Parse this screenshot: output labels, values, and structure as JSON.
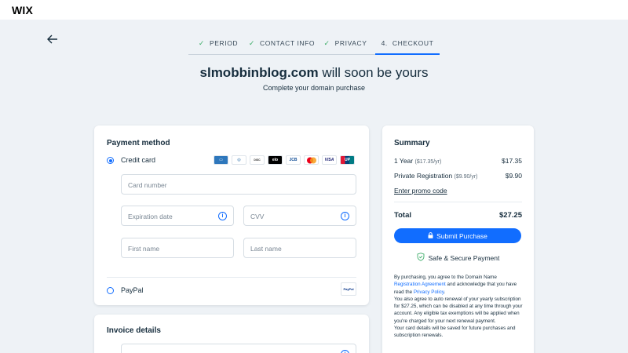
{
  "brand": {
    "logo": "WIX"
  },
  "steps": [
    {
      "label": "PERIOD",
      "done": true
    },
    {
      "label": "CONTACT INFO",
      "done": true
    },
    {
      "label": "PRIVACY",
      "done": true
    },
    {
      "number": "4.",
      "label": "CHECKOUT",
      "active": true
    }
  ],
  "header": {
    "domain": "slmobbinblog.com",
    "title_rest": " will soon be yours",
    "subtitle": "Complete your domain purchase"
  },
  "payment": {
    "title": "Payment method",
    "credit_card_label": "Credit card",
    "card_logos": [
      "AMEX",
      "DINERS",
      "DISCOVER",
      "elo",
      "JCB",
      "MC",
      "VISA",
      "UP"
    ],
    "fields": {
      "card_number": "Card number",
      "expiration": "Expiration date",
      "cvv": "CVV",
      "first_name": "First name",
      "last_name": "Last name"
    },
    "paypal_label": "PayPal",
    "paypal_logo": "PayPal"
  },
  "invoice": {
    "title": "Invoice details"
  },
  "summary": {
    "title": "Summary",
    "rows": [
      {
        "label": "1 Year",
        "detail": "($17.35/yr)",
        "amount": "$17.35"
      },
      {
        "label": "Private Registration",
        "detail": "($9.90/yr)",
        "amount": "$9.90"
      }
    ],
    "promo_link": "Enter promo code",
    "total_label": "Total",
    "total_amount": "$27.25",
    "submit_label": "Submit Purchase",
    "secure_label": "Safe & Secure Payment",
    "legal": {
      "l1": "By purchasing, you agree to the Domain Name ",
      "link1": "Registration Agreement",
      "l2": " and acknowledge that you have read the ",
      "link2": "Privacy Policy",
      "l3": ".",
      "p2": "You also agree to auto renewal of your yearly subscription for $27.25, which can be disabled at any time through your account. Any eligible tax exemptions will be applied when you're charged for your next renewal payment.",
      "p3": "Your card details will be saved for future purchases and subscription renewals."
    }
  },
  "colors": {
    "accent": "#116dff",
    "check": "#3fae6a",
    "background": "#eef2f6"
  },
  "icons": {
    "back": "arrow-left-icon",
    "lock": "lock-icon",
    "shield": "shield-check-icon",
    "info": "info-icon"
  }
}
